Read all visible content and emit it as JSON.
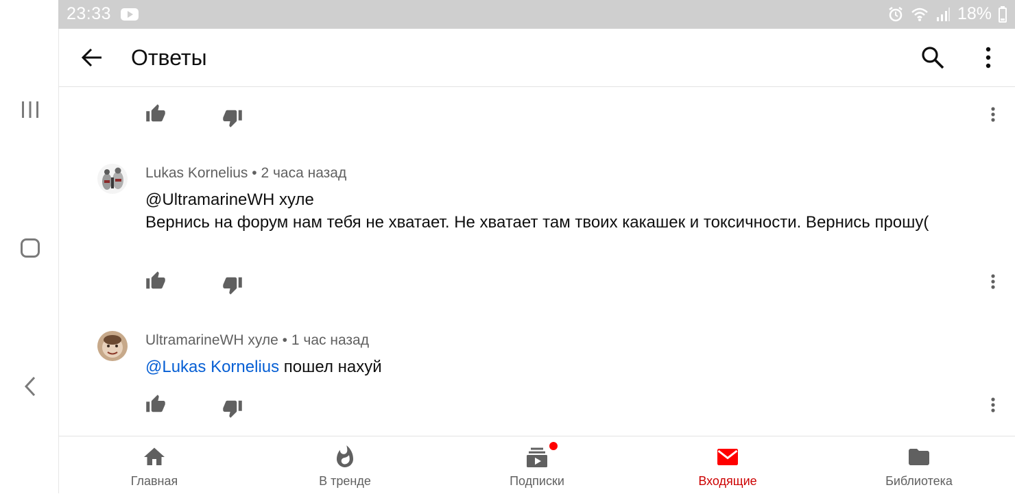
{
  "status_bar": {
    "time": "23:33",
    "battery": "18%"
  },
  "header": {
    "title": "Ответы"
  },
  "comments": [
    {
      "author": "Lukas Kornelius",
      "separator": "•",
      "time": "2 часа назад",
      "mention": "@UltramarineWH хуле",
      "text": "Вернись на форум нам тебя не хватает. Не хватает там твоих какашек и токсичности. Вернись прошу("
    },
    {
      "author": "UltramarineWH хуле",
      "separator": "•",
      "time": "1 час назад",
      "mention": "@Lukas Kornelius",
      "text": " пошел нахуй"
    }
  ],
  "bottom_nav": {
    "home": "Главная",
    "trending": "В тренде",
    "subscriptions": "Подписки",
    "inbox": "Входящие",
    "library": "Библиотека"
  },
  "colors": {
    "accent": "#cc0000",
    "mention": "#065fd4",
    "status_bar": "#cfcfcf"
  },
  "icons": [
    "back-arrow-icon",
    "search-icon",
    "more-vert-icon",
    "like-icon",
    "dislike-icon",
    "home-icon",
    "fire-icon",
    "subscriptions-icon",
    "mail-icon",
    "folder-icon"
  ]
}
